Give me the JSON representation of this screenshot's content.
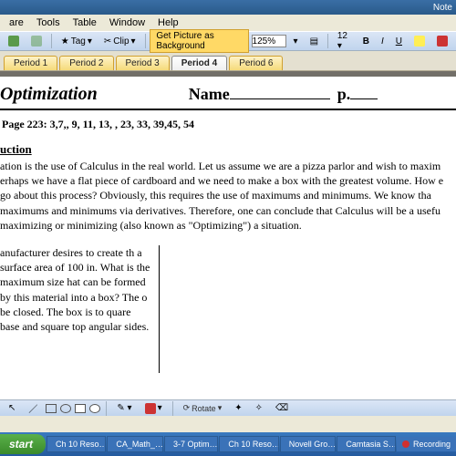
{
  "app": {
    "title_suffix": "Note"
  },
  "menu": {
    "items": [
      "are",
      "Tools",
      "Table",
      "Window",
      "Help"
    ]
  },
  "toolbar": {
    "tag_label": "Tag",
    "clip_label": "Clip",
    "get_picture": "Get Picture as Background",
    "zoom": "125%",
    "bold": "B",
    "italic": "I",
    "underline": "U"
  },
  "tabs": [
    {
      "label": "Period 1",
      "active": false
    },
    {
      "label": "Period 2",
      "active": false
    },
    {
      "label": "Period 3",
      "active": false
    },
    {
      "label": "Period 4",
      "active": true
    },
    {
      "label": "Period 6",
      "active": false
    }
  ],
  "doc": {
    "title": "Optimization",
    "name_label": "Name",
    "p_label": "p.",
    "hw": "Page 223: 3,7,, 9, 11, 13, , 23, 33, 39,45, 54",
    "intro_heading": "uction",
    "intro_body": "ation is the use of Calculus in the real world. Let us assume we are a pizza parlor and wish to maxim erhaps we have a flat piece of cardboard and we need to make a box with the greatest volume. How e go about this process?  Obviously, this requires the use of maximums and minimums. We know tha maximums and minimums via derivatives. Therefore, one can conclude that Calculus will be a usefu maximizing or minimizing (also known as \"Optimizing\") a situation.",
    "problem": "anufacturer desires to create th a surface area of 100 in. What is the maximum size hat can be formed by this material into a box? The o be closed.  The box is to quare base and square top angular sides."
  },
  "bottom": {
    "rotate": "Rotate"
  },
  "taskbar": {
    "start": "start",
    "items": [
      "Ch 10 Reso…",
      "CA_Math_…",
      "3-7  Optim…",
      "Ch 10 Reso…",
      "Novell Gro…",
      "Camtasia S…"
    ],
    "tray": "Recording"
  }
}
